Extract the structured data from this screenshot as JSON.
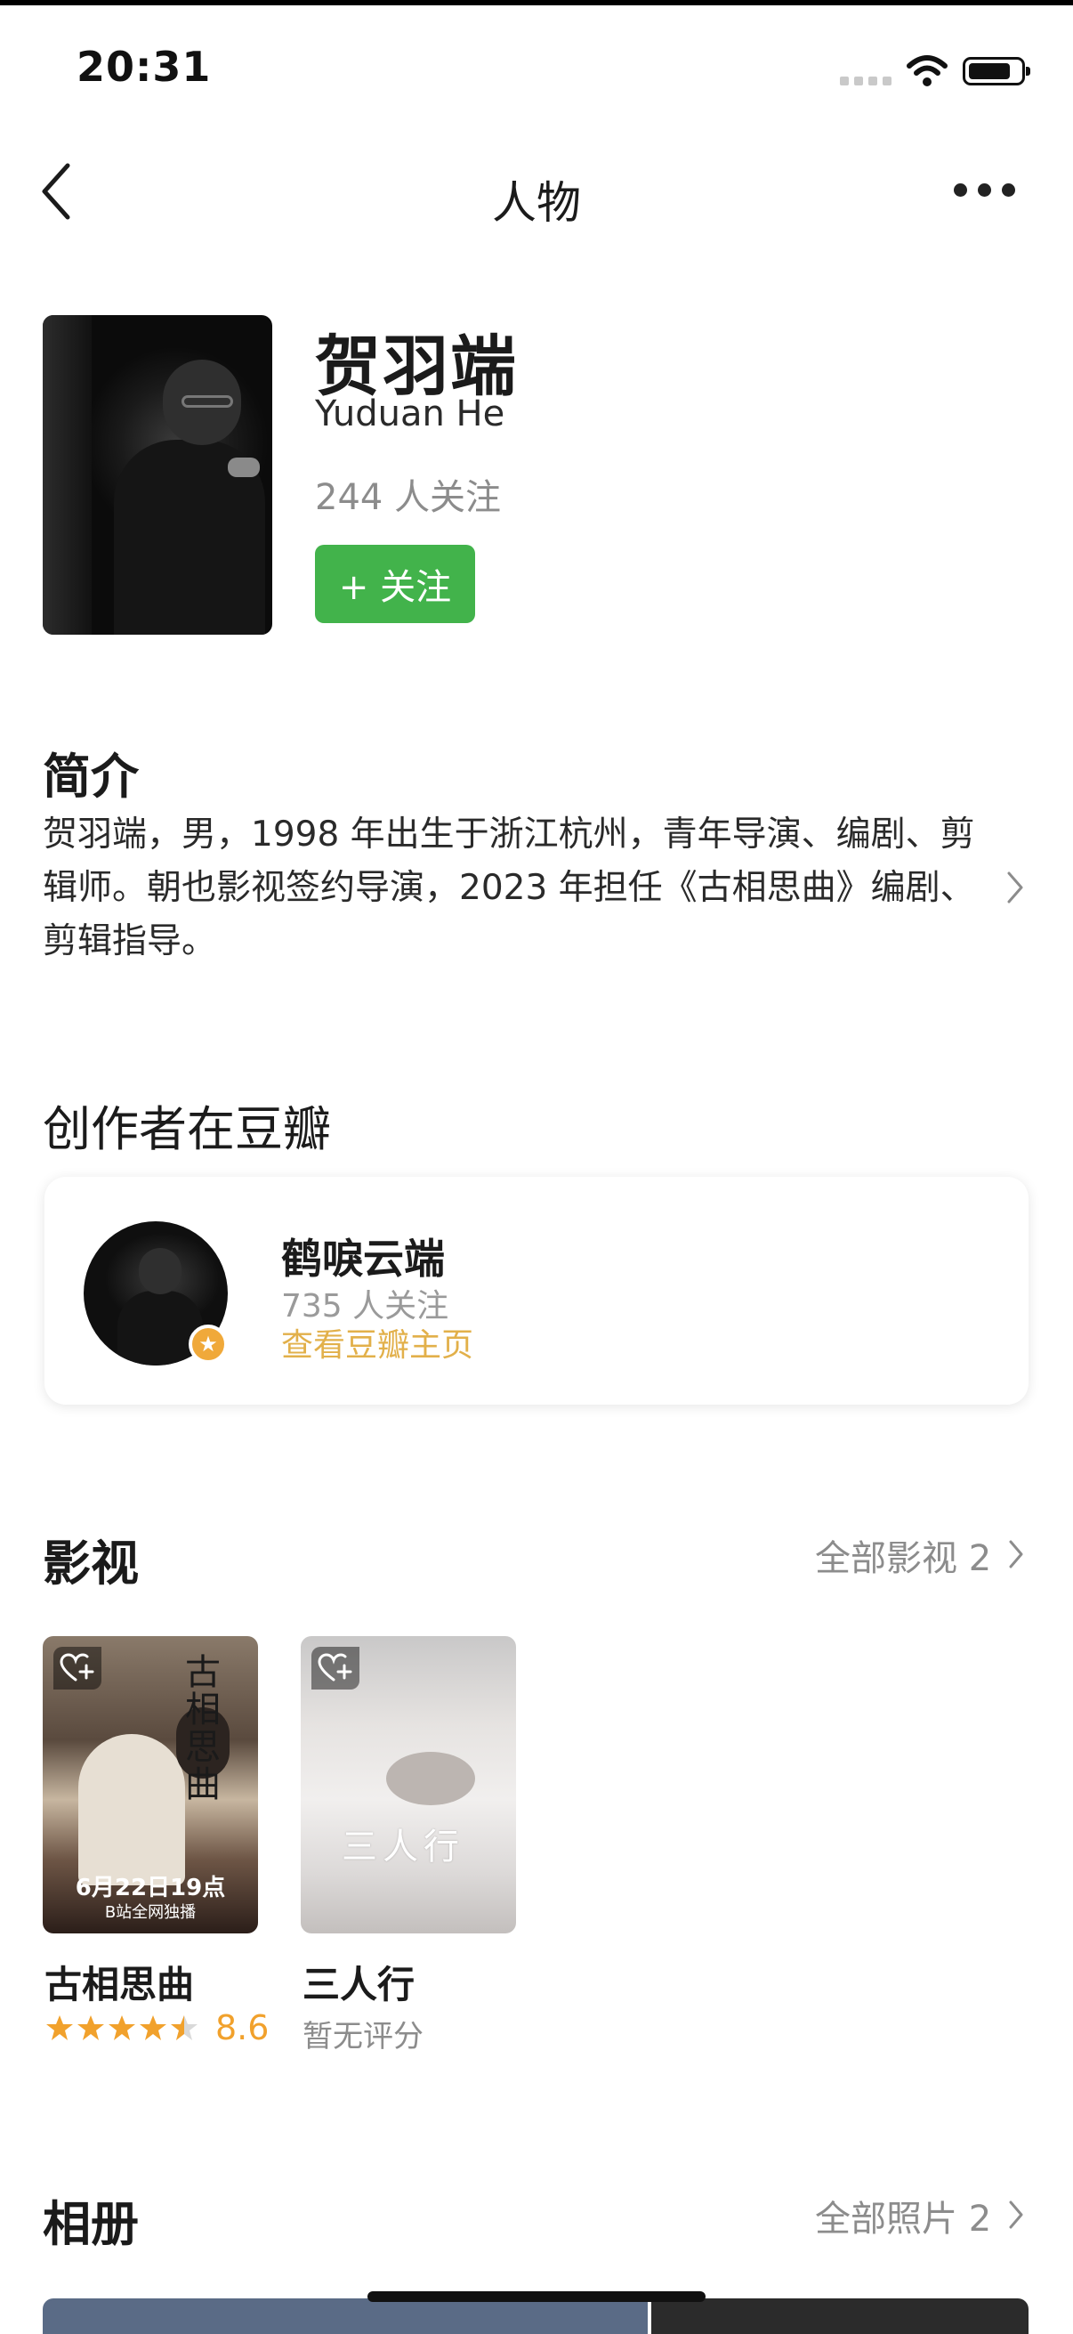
{
  "status_bar": {
    "time": "20:31"
  },
  "nav": {
    "title": "人物",
    "back_icon": "chevron-left-icon",
    "more_icon": "more-dots-icon"
  },
  "profile": {
    "name": "贺羽端",
    "name_en": "Yuduan He",
    "followers": "244 人关注",
    "follow_button": "+ 关注",
    "follow_button_color": "#42b34b"
  },
  "intro": {
    "heading": "简介",
    "text": "贺羽端，男，1998 年出生于浙江杭州，青年导演、编剧、剪辑师。朝也影视签约导演，2023 年担任《古相思曲》编剧、剪辑指导。"
  },
  "creator": {
    "heading": "创作者在豆瓣",
    "name": "鹤唳云端",
    "followers": "735 人关注",
    "link": "查看豆瓣主页",
    "link_color": "#e2b04a"
  },
  "movies": {
    "heading": "影视",
    "all_label": "全部影视 2",
    "items": [
      {
        "title": "古相思曲",
        "rating": "8.6",
        "stars": 4.5,
        "poster_title": "古相思曲",
        "poster_date": "6月22日19点",
        "poster_sub": "B站全网独播"
      },
      {
        "title": "三人行",
        "rating_text": "暂无评分",
        "poster_title": "三人行"
      }
    ]
  },
  "album": {
    "heading": "相册",
    "all_label": "全部照片 2"
  }
}
